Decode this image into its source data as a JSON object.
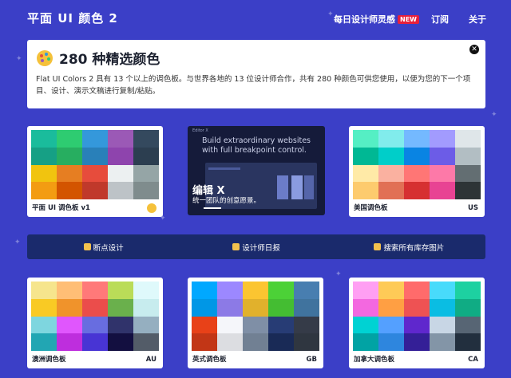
{
  "header": {
    "logo": "平面 UI 颜色 2",
    "nav": {
      "inspiration": "每日设计师灵感",
      "badge": "NEW",
      "subscribe": "订阅",
      "about": "关于"
    }
  },
  "intro": {
    "title": "280 种精选颜色",
    "close_icon": "close-icon",
    "description": "Flat UI Colors 2 具有 13 个以上的调色板。与世界各地的 13 位设计师合作，共有 280 种颜色可供您使用，以便为您的下一个项目、设计、演示文稿进行复制/粘贴。"
  },
  "palettes": [
    {
      "label": "平面 UI 调色板 v1",
      "tag": "",
      "icon": "palette-icon",
      "colors": [
        "#1abc9c",
        "#2ecc71",
        "#3498db",
        "#9b59b6",
        "#34495e",
        "#16a085",
        "#27ae60",
        "#2980b9",
        "#8e44ad",
        "#2c3e50",
        "#f1c40f",
        "#e67e22",
        "#e74c3c",
        "#ecf0f1",
        "#95a5a6",
        "#f39c12",
        "#d35400",
        "#c0392b",
        "#bdc3c7",
        "#7f8c8d"
      ]
    },
    {
      "label": "美国调色板",
      "tag": "US",
      "icon": "",
      "colors": [
        "#55efc4",
        "#81ecec",
        "#74b9ff",
        "#a29bfe",
        "#dfe6e9",
        "#00b894",
        "#00cec9",
        "#0984e3",
        "#6c5ce7",
        "#b2bec3",
        "#ffeaa7",
        "#fab1a0",
        "#ff7675",
        "#fd79a8",
        "#636e72",
        "#fdcb6e",
        "#e17055",
        "#d63031",
        "#e84393",
        "#2d3436"
      ]
    },
    {
      "label": "澳洲调色板",
      "tag": "AU",
      "icon": "",
      "colors": [
        "#f6e58d",
        "#ffbe76",
        "#ff7979",
        "#badc58",
        "#dff9fb",
        "#f9ca24",
        "#f0932b",
        "#eb4d4b",
        "#6ab04c",
        "#c7ecee",
        "#7ed6df",
        "#e056fd",
        "#686de0",
        "#30336b",
        "#95afc0",
        "#22a6b3",
        "#be2edd",
        "#4834d4",
        "#130f40",
        "#535c68"
      ]
    },
    {
      "label": "英式调色板",
      "tag": "GB",
      "icon": "",
      "colors": [
        "#00a8ff",
        "#9c88ff",
        "#fbc531",
        "#4cd137",
        "#487eb0",
        "#0097e6",
        "#8c7ae6",
        "#e1b12c",
        "#44bd32",
        "#40739e",
        "#e84118",
        "#f5f6fa",
        "#7f8fa6",
        "#273c75",
        "#353b48",
        "#c23616",
        "#dcdde1",
        "#718093",
        "#192a56",
        "#2f3640"
      ]
    },
    {
      "label": "加拿大调色板",
      "tag": "CA",
      "icon": "",
      "colors": [
        "#ff9ff3",
        "#feca57",
        "#ff6b6b",
        "#48dbfb",
        "#1dd1a1",
        "#f368e0",
        "#ff9f43",
        "#ee5253",
        "#0abde3",
        "#10ac84",
        "#00d2d3",
        "#54a0ff",
        "#5f27cd",
        "#c8d6e5",
        "#576574",
        "#01a3a4",
        "#2e86de",
        "#341f97",
        "#8395a7",
        "#222f3e"
      ]
    }
  ],
  "ad": {
    "brand": "Editor X",
    "headline": "Build extraordinary websites with full breakpoint control.",
    "title": "编辑 X",
    "subtitle": "统一团队的创意愿景。"
  },
  "links": [
    {
      "icon": "thumbs-up-icon",
      "label": "断点设计"
    },
    {
      "icon": "thumbs-up-icon",
      "label": "设计师日报"
    },
    {
      "icon": "hand-icon",
      "label": "搜索所有库存图片"
    }
  ],
  "colors": {
    "background": "#3b3fc7",
    "linkbar": "#1a2a6c",
    "badge": "#e8203c"
  }
}
